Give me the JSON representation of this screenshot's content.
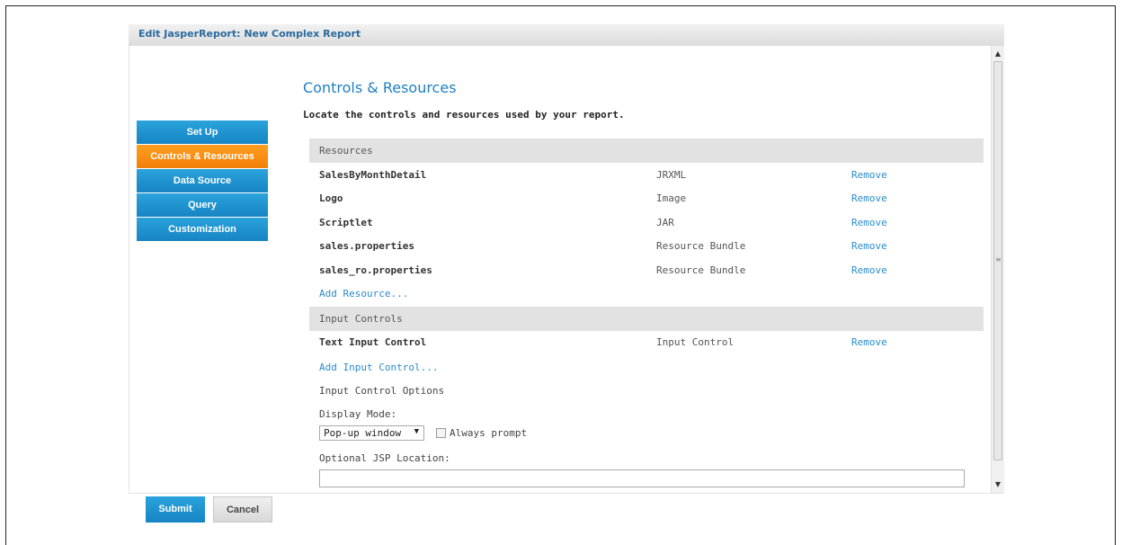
{
  "window": {
    "title": "Edit JasperReport: New Complex Report"
  },
  "nav": {
    "items": [
      {
        "label": "Set Up"
      },
      {
        "label": "Controls & Resources"
      },
      {
        "label": "Data Source"
      },
      {
        "label": "Query"
      },
      {
        "label": "Customization"
      }
    ],
    "active_index": 1
  },
  "main": {
    "heading": "Controls & Resources",
    "subheading": "Locate the controls and resources used by your report.",
    "resources": {
      "header": "Resources",
      "rows": [
        {
          "name": "SalesByMonthDetail",
          "type": "JRXML",
          "action": "Remove"
        },
        {
          "name": "Logo",
          "type": "Image",
          "action": "Remove"
        },
        {
          "name": "Scriptlet",
          "type": "JAR",
          "action": "Remove"
        },
        {
          "name": "sales.properties",
          "type": "Resource Bundle",
          "action": "Remove"
        },
        {
          "name": "sales_ro.properties",
          "type": "Resource Bundle",
          "action": "Remove"
        }
      ],
      "add_link": "Add Resource..."
    },
    "input_controls": {
      "header": "Input Controls",
      "rows": [
        {
          "name": "Text Input Control",
          "type": "Input Control",
          "action": "Remove"
        }
      ],
      "add_link": "Add Input Control...",
      "options_label": "Input Control Options",
      "display_mode_label": "Display Mode:",
      "display_mode_value": "Pop-up window",
      "always_prompt_label": "Always prompt",
      "always_prompt_checked": false,
      "jsp_location_label": "Optional JSP Location:",
      "jsp_location_value": ""
    }
  },
  "footer": {
    "submit_label": "Submit",
    "cancel_label": "Cancel"
  },
  "colors": {
    "accent": "#1e7fc2",
    "nav_blue": "#1784c4",
    "nav_active": "#f27f07",
    "link": "#2a8ccc"
  }
}
